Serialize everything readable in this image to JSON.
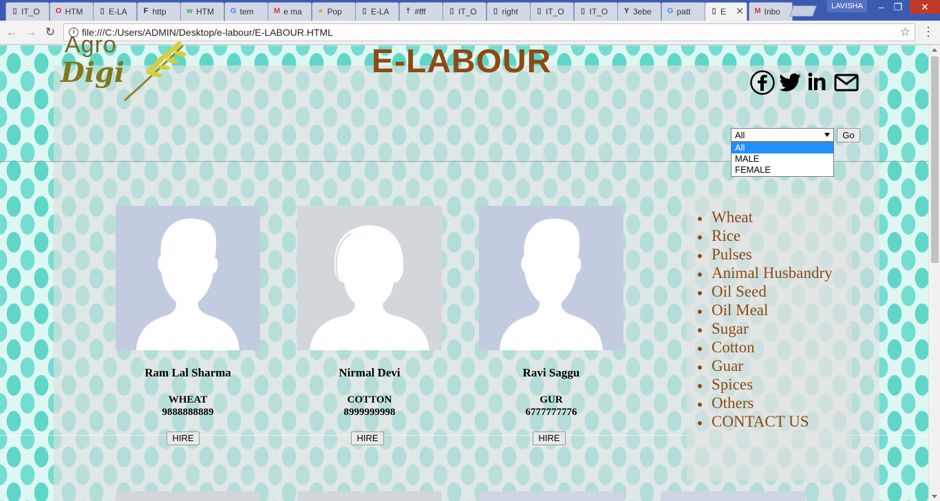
{
  "browser": {
    "tabs": [
      {
        "label": "IT_O",
        "icon": "doc-icon"
      },
      {
        "label": "HTM",
        "icon": "opera-icon"
      },
      {
        "label": "E-LA",
        "icon": "doc-icon"
      },
      {
        "label": "http",
        "icon": "flo-icon"
      },
      {
        "label": "HTM",
        "icon": "w3-icon"
      },
      {
        "label": "tem",
        "icon": "google-icon"
      },
      {
        "label": "e ma",
        "icon": "gmail-icon"
      },
      {
        "label": "Pop",
        "icon": "pop-icon"
      },
      {
        "label": "E-LA",
        "icon": "doc-icon"
      },
      {
        "label": "#fff",
        "icon": "pin-icon"
      },
      {
        "label": "IT_O",
        "icon": "doc-icon"
      },
      {
        "label": "right",
        "icon": "doc-icon"
      },
      {
        "label": "IT_O",
        "icon": "doc-icon"
      },
      {
        "label": "IT_O",
        "icon": "doc-icon"
      },
      {
        "label": "3ebe",
        "icon": "ym-icon"
      },
      {
        "label": "patt",
        "icon": "google-icon"
      },
      {
        "label": "E",
        "icon": "doc-icon",
        "active": true
      },
      {
        "label": "Inbo",
        "icon": "gmail-icon"
      }
    ],
    "user": "LAVISHA",
    "url": "file:///C:/Users/ADMIN/Desktop/e-labour/E-LABOUR.HTML"
  },
  "header": {
    "logo_top": "Agro",
    "logo_bottom": "Digi",
    "title": "E-LABOUR",
    "socials": [
      "facebook-icon",
      "twitter-icon",
      "linkedin-icon",
      "mail-icon"
    ]
  },
  "filter": {
    "selected": "All",
    "options": [
      "All",
      "MALE",
      "FEMALE"
    ],
    "go_label": "Go"
  },
  "workers": [
    {
      "name": "Ram Lal Sharma",
      "crop": "WHEAT",
      "phone": "9888888889",
      "gender": "male",
      "hire_label": "HIRE"
    },
    {
      "name": "Nirmal Devi",
      "crop": "COTTON",
      "phone": "8999999998",
      "gender": "female",
      "hire_label": "HIRE"
    },
    {
      "name": "Ravi Saggu",
      "crop": "GUR",
      "phone": "6777777776",
      "gender": "male",
      "hire_label": "HIRE"
    }
  ],
  "categories": [
    "Wheat",
    "Rice",
    "Pulses",
    "Animal Husbandry",
    "Oil Seed",
    "Oil Meal",
    "Sugar",
    "Cotton",
    "Guar",
    "Spices",
    "Others",
    "CONTACT US"
  ],
  "colors": {
    "accent": "#8c4a14",
    "pattern": "#5fd6c8",
    "chrome": "#3b5bb3",
    "selected_option": "#1e90ff"
  }
}
